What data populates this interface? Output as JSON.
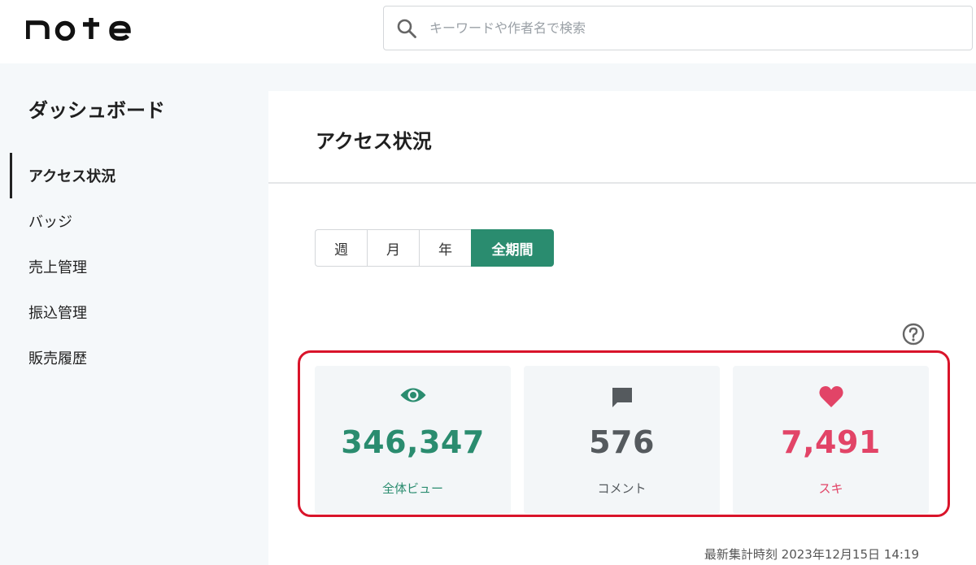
{
  "header": {
    "logo_text": "note",
    "search": {
      "placeholder": "キーワードや作者名で検索",
      "value": ""
    }
  },
  "sidebar": {
    "title": "ダッシュボード",
    "items": [
      {
        "label": "アクセス状況",
        "active": true
      },
      {
        "label": "バッジ",
        "active": false
      },
      {
        "label": "売上管理",
        "active": false
      },
      {
        "label": "振込管理",
        "active": false
      },
      {
        "label": "販売履歴",
        "active": false
      }
    ]
  },
  "main": {
    "title": "アクセス状況",
    "period_tabs": [
      {
        "label": "週",
        "active": false
      },
      {
        "label": "月",
        "active": false
      },
      {
        "label": "年",
        "active": false
      },
      {
        "label": "全期間",
        "active": true
      }
    ],
    "stats": [
      {
        "key": "views",
        "icon": "eye-icon",
        "value": "346,347",
        "label": "全体ビュー",
        "color": "#2a8c6f"
      },
      {
        "key": "comments",
        "icon": "comment-icon",
        "value": "576",
        "label": "コメント",
        "color": "#555a5e"
      },
      {
        "key": "likes",
        "icon": "heart-icon",
        "value": "7,491",
        "label": "スキ",
        "color": "#e24467"
      }
    ],
    "updated": {
      "label": "最新集計時刻",
      "datetime": "2023年12月15日 14:19"
    }
  },
  "colors": {
    "accent": "#2a8c6f",
    "like": "#e24467",
    "highlight": "#d9142a"
  }
}
